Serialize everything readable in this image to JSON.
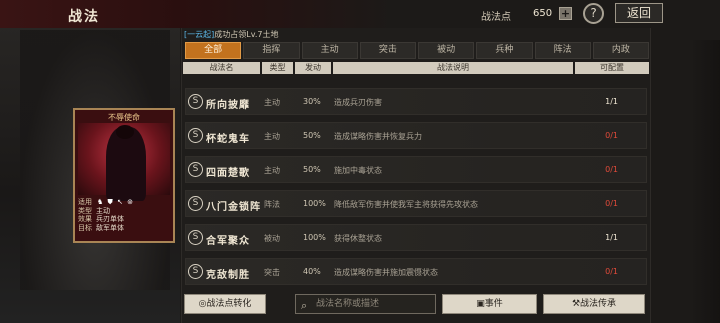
{
  "header": {
    "title": "战法",
    "points_label": "战法点",
    "points_value": "650",
    "plus": "+",
    "help": "?",
    "back": "返回"
  },
  "notice": {
    "highlight": "[一云起]",
    "text": "成功占领Lv.7土地"
  },
  "tabs": [
    "全部",
    "指挥",
    "主动",
    "突击",
    "被动",
    "兵种",
    "阵法",
    "内政"
  ],
  "active_tab": "全部",
  "columns": [
    "战法名",
    "类型",
    "发动",
    "战法说明",
    "可配置"
  ],
  "tactics": [
    {
      "icon": "S",
      "name": "所向披靡",
      "type": "主动",
      "rate": "30%",
      "desc": "造成兵刃伤害",
      "cap": "1/1",
      "cap_color": "#efe6d3"
    },
    {
      "icon": "S",
      "name": "杯蛇鬼车",
      "type": "主动",
      "rate": "50%",
      "desc": "造成谋略伤害并恢复兵力",
      "cap": "0/1",
      "cap_color": "#e04a3a"
    },
    {
      "icon": "S",
      "name": "四面楚歌",
      "type": "主动",
      "rate": "50%",
      "desc": "施加中毒状态",
      "cap": "0/1",
      "cap_color": "#e04a3a"
    },
    {
      "icon": "S",
      "name": "八门金锁阵",
      "type": "阵法",
      "rate": "100%",
      "desc": "降低敌军伤害并使我军主将获得先攻状态",
      "cap": "0/1",
      "cap_color": "#e04a3a"
    },
    {
      "icon": "S",
      "name": "合军聚众",
      "type": "被动",
      "rate": "100%",
      "desc": "获得休整状态",
      "cap": "1/1",
      "cap_color": "#efe6d3"
    },
    {
      "icon": "S",
      "name": "克敌制胜",
      "type": "突击",
      "rate": "40%",
      "desc": "造成谋略伤害并施加震慑状态",
      "cap": "0/1",
      "cap_color": "#e04a3a"
    }
  ],
  "card": {
    "title": "不辱使命",
    "lines": [
      {
        "label": "适用",
        "value": ""
      },
      {
        "label": "类型",
        "value": "主动"
      },
      {
        "label": "效果",
        "value": "兵刃单体"
      },
      {
        "label": "目标",
        "value": "敌军单体"
      }
    ],
    "unit_icons": "♞ ⛊ ↖ ⊚"
  },
  "bottom": {
    "convert_label": "战法点转化",
    "search_placeholder": "战法名称或描述",
    "event_label": "事件",
    "inherit_label": "战法传承"
  }
}
